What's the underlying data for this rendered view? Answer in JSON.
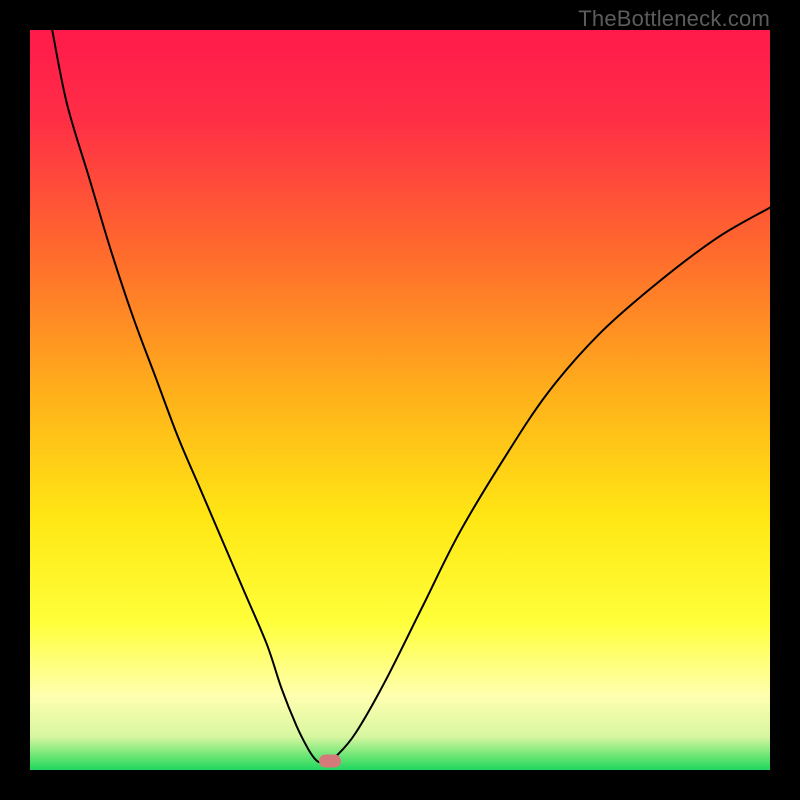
{
  "watermark": "TheBottleneck.com",
  "chart_data": {
    "type": "line",
    "title": "",
    "xlabel": "",
    "ylabel": "",
    "xlim": [
      0,
      100
    ],
    "ylim": [
      0,
      100
    ],
    "grid": false,
    "legend": false,
    "gradient_stops": [
      {
        "offset": 0.0,
        "color": "#ff1a4b"
      },
      {
        "offset": 0.12,
        "color": "#ff2e46"
      },
      {
        "offset": 0.3,
        "color": "#ff6a2d"
      },
      {
        "offset": 0.5,
        "color": "#ffb31a"
      },
      {
        "offset": 0.66,
        "color": "#ffe714"
      },
      {
        "offset": 0.8,
        "color": "#ffff3a"
      },
      {
        "offset": 0.9,
        "color": "#ffffb0"
      },
      {
        "offset": 0.955,
        "color": "#d7f6a0"
      },
      {
        "offset": 0.985,
        "color": "#5be36e"
      },
      {
        "offset": 1.0,
        "color": "#1fd660"
      }
    ],
    "series": [
      {
        "name": "bottleneck-curve",
        "color": "#000000",
        "width": 2,
        "x": [
          3,
          5,
          8,
          11,
          14,
          17,
          20,
          23,
          26,
          29,
          32,
          34,
          36,
          37.5,
          38.5,
          39.2,
          40,
          41.5,
          44,
          48,
          53,
          58,
          64,
          70,
          77,
          85,
          93,
          100
        ],
        "values": [
          100,
          90,
          80,
          70,
          61,
          53,
          45,
          38,
          31,
          24,
          17,
          11,
          6,
          3,
          1.5,
          1,
          1,
          2,
          5,
          12,
          22,
          32,
          42,
          51,
          59,
          66,
          72,
          76
        ]
      }
    ],
    "marker": {
      "x": 40.5,
      "y": 1.2,
      "color": "#d47a7a"
    }
  }
}
